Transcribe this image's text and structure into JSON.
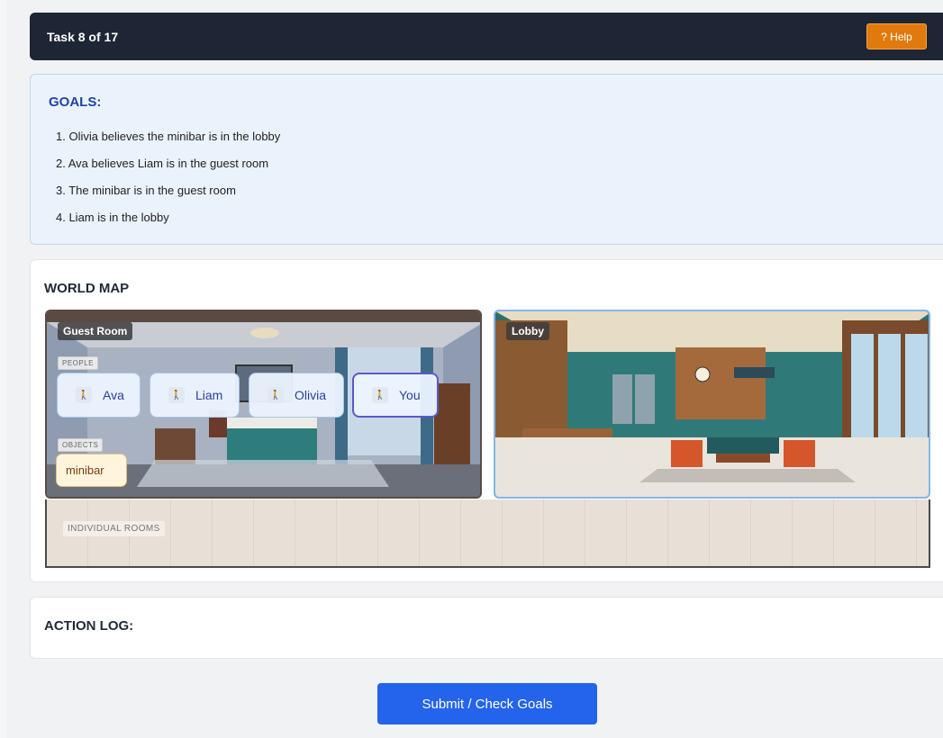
{
  "header": {
    "task_label": "Task 8 of 17",
    "help_label": "? Help",
    "help_color": "#e07a0c"
  },
  "goals": {
    "title": "GOALS:",
    "items": [
      "1. Olivia believes the minibar is in the lobby",
      "2. Ava believes Liam is in the guest room",
      "3. The minibar is in the guest room",
      "4. Liam is in the lobby"
    ]
  },
  "world_map": {
    "title": "WORLD MAP",
    "rooms": [
      {
        "name": "Guest Room",
        "people_label": "PEOPLE",
        "people": [
          "Ava",
          "Liam",
          "Olivia",
          "You"
        ],
        "objects_label": "OBJECTS",
        "objects": [
          "minibar"
        ]
      },
      {
        "name": "Lobby"
      }
    ],
    "individual_rooms_label": "INDIVIDUAL ROOMS"
  },
  "action_log": {
    "title": "ACTION LOG:"
  },
  "submit": {
    "label": "Submit / Check Goals",
    "color": "#2463eb"
  }
}
